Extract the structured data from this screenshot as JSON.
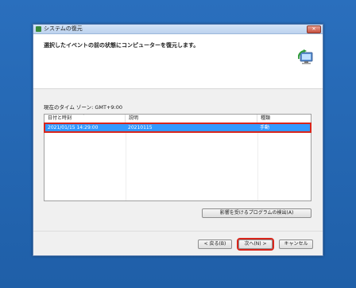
{
  "window": {
    "title": "システムの復元",
    "close_glyph": "✕"
  },
  "header": {
    "instruction": "選択したイベントの前の状態にコンピューターを復元します。",
    "icon": "system-restore-icon"
  },
  "timezone": "現在のタイム ゾーン: GMT+9:00",
  "table": {
    "columns": [
      "日付と時刻",
      "説明",
      "種類"
    ],
    "sort_glyph": "ˇ",
    "rows": [
      {
        "date": "2021/01/15 14:29:00",
        "description": "20210115",
        "type": "手動",
        "selected": true
      }
    ]
  },
  "buttons": {
    "detect": "影響を受けるプログラムの検出(A)",
    "back": "< 戻る(B)",
    "next": "次へ(N) >",
    "cancel": "キャンセル"
  },
  "colors": {
    "selection": "#3399ff",
    "highlight": "#d9261c",
    "desktop": "#2468b4"
  }
}
